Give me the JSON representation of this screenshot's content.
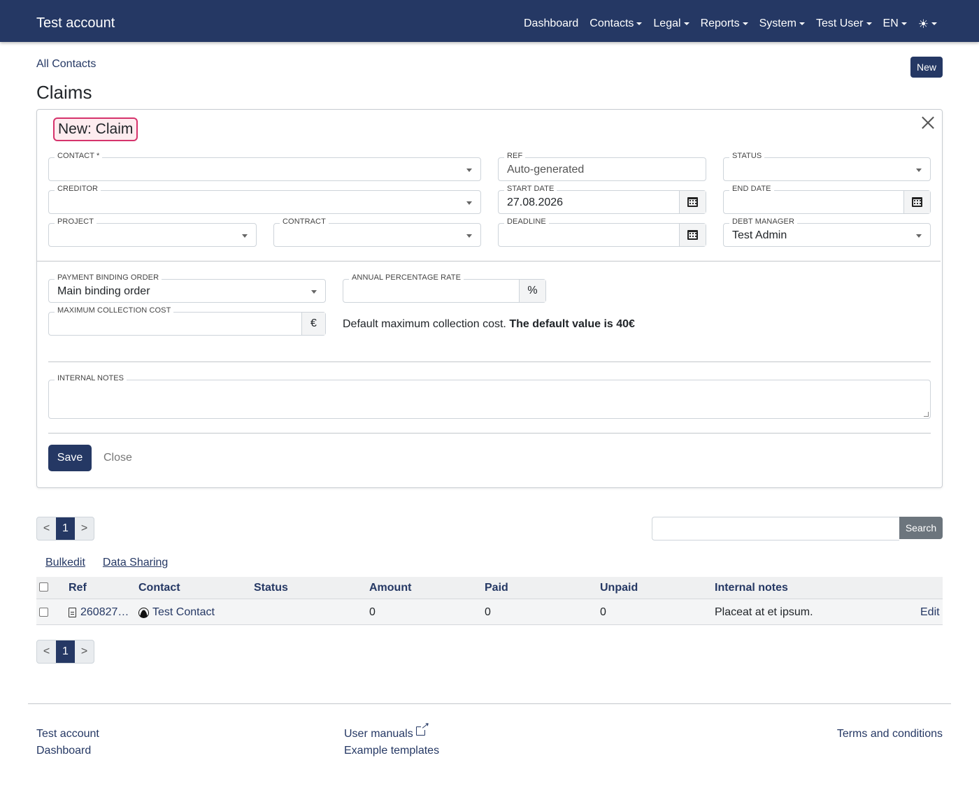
{
  "navbar": {
    "brand": "Test account",
    "items": [
      "Dashboard",
      "Contacts",
      "Legal",
      "Reports",
      "System",
      "Test User",
      "EN"
    ],
    "theme_icon": "sun-icon"
  },
  "breadcrumb": "All Contacts",
  "new_button": "New",
  "page_title": "Claims",
  "form": {
    "title": "New: Claim",
    "contact_label": "CONTACT *",
    "contact_value": "",
    "ref_label": "REF",
    "ref_value": "Auto-generated",
    "status_label": "STATUS",
    "status_value": "",
    "creditor_label": "CREDITOR",
    "creditor_value": "",
    "start_date_label": "START DATE",
    "start_date_value": "27.08.2026",
    "end_date_label": "END DATE",
    "end_date_value": "",
    "project_label": "PROJECT",
    "project_value": "",
    "contract_label": "CONTRACT",
    "contract_value": "",
    "deadline_label": "DEADLINE",
    "deadline_value": "",
    "debt_manager_label": "DEBT MANAGER",
    "debt_manager_value": "Test Admin",
    "payment_binding_label": "PAYMENT BINDING ORDER",
    "payment_binding_value": "Main binding order",
    "apr_label": "ANNUAL PERCENTAGE RATE",
    "apr_value": "",
    "apr_unit": "%",
    "max_cost_label": "MAXIMUM COLLECTION COST",
    "max_cost_value": "",
    "max_cost_unit": "€",
    "helper_text": "Default maximum collection cost.",
    "helper_bold": "The default value is 40€",
    "notes_label": "INTERNAL NOTES",
    "notes_value": "",
    "save_label": "Save",
    "close_label": "Close"
  },
  "pagination": {
    "prev": "<",
    "current": "1",
    "next": ">"
  },
  "search": {
    "button": "Search",
    "value": ""
  },
  "links": {
    "bulkedit": "Bulkedit",
    "data_sharing": "Data Sharing"
  },
  "table": {
    "headers": [
      "Ref",
      "Contact",
      "Status",
      "Amount",
      "Paid",
      "Unpaid",
      "Internal notes"
    ],
    "rows": [
      {
        "ref": "260827…",
        "contact": "Test Contact",
        "status": "",
        "amount": "0",
        "paid": "0",
        "unpaid": "0",
        "notes": "Placeat at et ipsum.",
        "action": "Edit"
      }
    ]
  },
  "footer": {
    "col1": [
      "Test account",
      "Dashboard"
    ],
    "col2": [
      "User manuals",
      "Example templates"
    ],
    "col3": [
      "Terms and conditions"
    ]
  }
}
